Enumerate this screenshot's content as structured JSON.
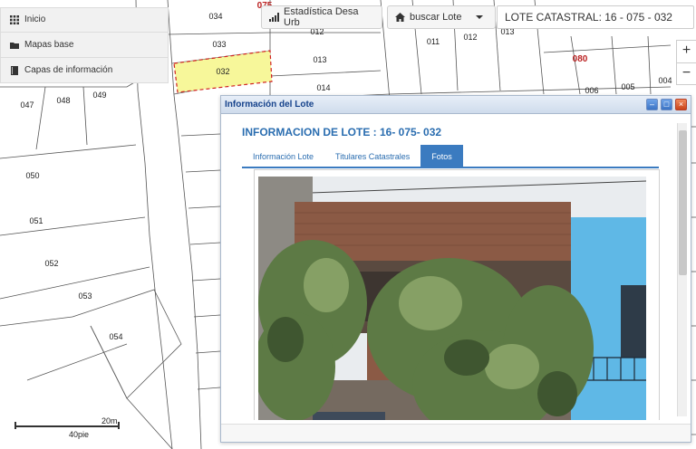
{
  "map": {
    "parcels": [
      "034",
      "033",
      "032",
      "012",
      "013",
      "014",
      "011",
      "012",
      "013",
      "005",
      "004",
      "006",
      "047",
      "048",
      "049",
      "050",
      "051",
      "052",
      "053",
      "054"
    ],
    "block_labels": [
      "080",
      "075"
    ],
    "selected_parcel": "032",
    "selected_color": "#f7f79a"
  },
  "menu": {
    "items": [
      {
        "icon": "grid-icon",
        "label": "Inicio"
      },
      {
        "icon": "folder-icon",
        "label": "Mapas base"
      },
      {
        "icon": "book-icon",
        "label": "Capas de información"
      }
    ]
  },
  "toolbar": {
    "stats_label": "Estadística Desa Urb",
    "search_label": "buscar Lote",
    "lote_value": "LOTE CATASTRAL: 16 - 075 - 032"
  },
  "zoom": {
    "in_label": "+",
    "out_label": "−"
  },
  "scale": {
    "meters": "20m",
    "feet": "40pie"
  },
  "dialog": {
    "title": "Información del Lote",
    "heading": "INFORMACION DE LOTE : 16- 075- 032",
    "tabs": [
      "Información Lote",
      "Titulares Catastrales",
      "Fotos"
    ],
    "active_tab": "Fotos",
    "buttons": {
      "minimize": "–",
      "maximize": "□",
      "close": "×"
    }
  },
  "colors": {
    "accent": "#3b7bc0",
    "title_text": "#15428b",
    "block_label": "#b22222"
  }
}
